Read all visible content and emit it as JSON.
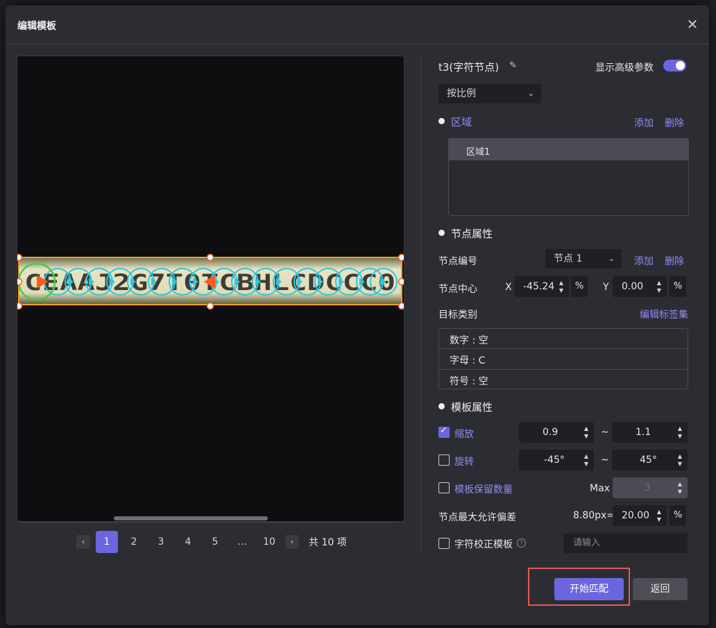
{
  "dialog": {
    "title": "编辑模板",
    "close_icon": "close-icon"
  },
  "preview": {
    "ocr_text": "CEAAJ2G7T0TCBHLCDCCC0",
    "pagination": {
      "prev_icon": "‹",
      "next_icon": "›",
      "pages": [
        "1",
        "2",
        "3",
        "4",
        "5",
        "...",
        "10"
      ],
      "active_page": "1",
      "total_label": "共 10 项"
    }
  },
  "node_panel": {
    "node_title": "t3(字符节点)",
    "edit_icon": "pencil-icon",
    "advanced_label": "显示高级参数",
    "advanced_on": true,
    "scale_mode": "按比例",
    "region": {
      "title": "区域",
      "add": "添加",
      "delete": "删除",
      "items": [
        "区域1"
      ]
    },
    "node_props": {
      "title": "节点属性",
      "node_id_label": "节点编号",
      "node_id_value": "节点 1",
      "add": "添加",
      "delete": "删除",
      "center_label": "节点中心",
      "x_label": "X",
      "x_value": "-45.24",
      "y_label": "Y",
      "y_value": "0.00",
      "unit": "%",
      "target_label": "目标类别",
      "edit_tags": "编辑标签集",
      "targets": [
        "数字 : 空",
        "字母 :  C",
        "符号 : 空"
      ]
    },
    "template_props": {
      "title": "模板属性",
      "scale_label": "缩放",
      "scale_checked": true,
      "scale_min": "0.9",
      "scale_max": "1.1",
      "rotate_label": "旋转",
      "rotate_checked": false,
      "rotate_min": "-45°",
      "rotate_max": "45°",
      "range_sep": "~",
      "keep_label": "模板保留数量",
      "keep_checked": false,
      "max_label": "Max",
      "max_value": "3",
      "deviation_label": "节点最大允许偏差",
      "deviation_px": "8.80px=",
      "deviation_value": "20.00",
      "deviation_unit": "%",
      "char_fix_label": "字符校正模板",
      "char_fix_checked": false,
      "char_fix_placeholder": "请输入"
    }
  },
  "footer": {
    "start_label": "开始匹配",
    "back_label": "返回"
  },
  "colors": {
    "accent": "#6b66e0",
    "highlight": "#e45c55",
    "node_ring": "#2ec7e0",
    "active_node": "#3ad04a",
    "bbox": "#f2a020",
    "arrow": "#ff5a1f"
  }
}
